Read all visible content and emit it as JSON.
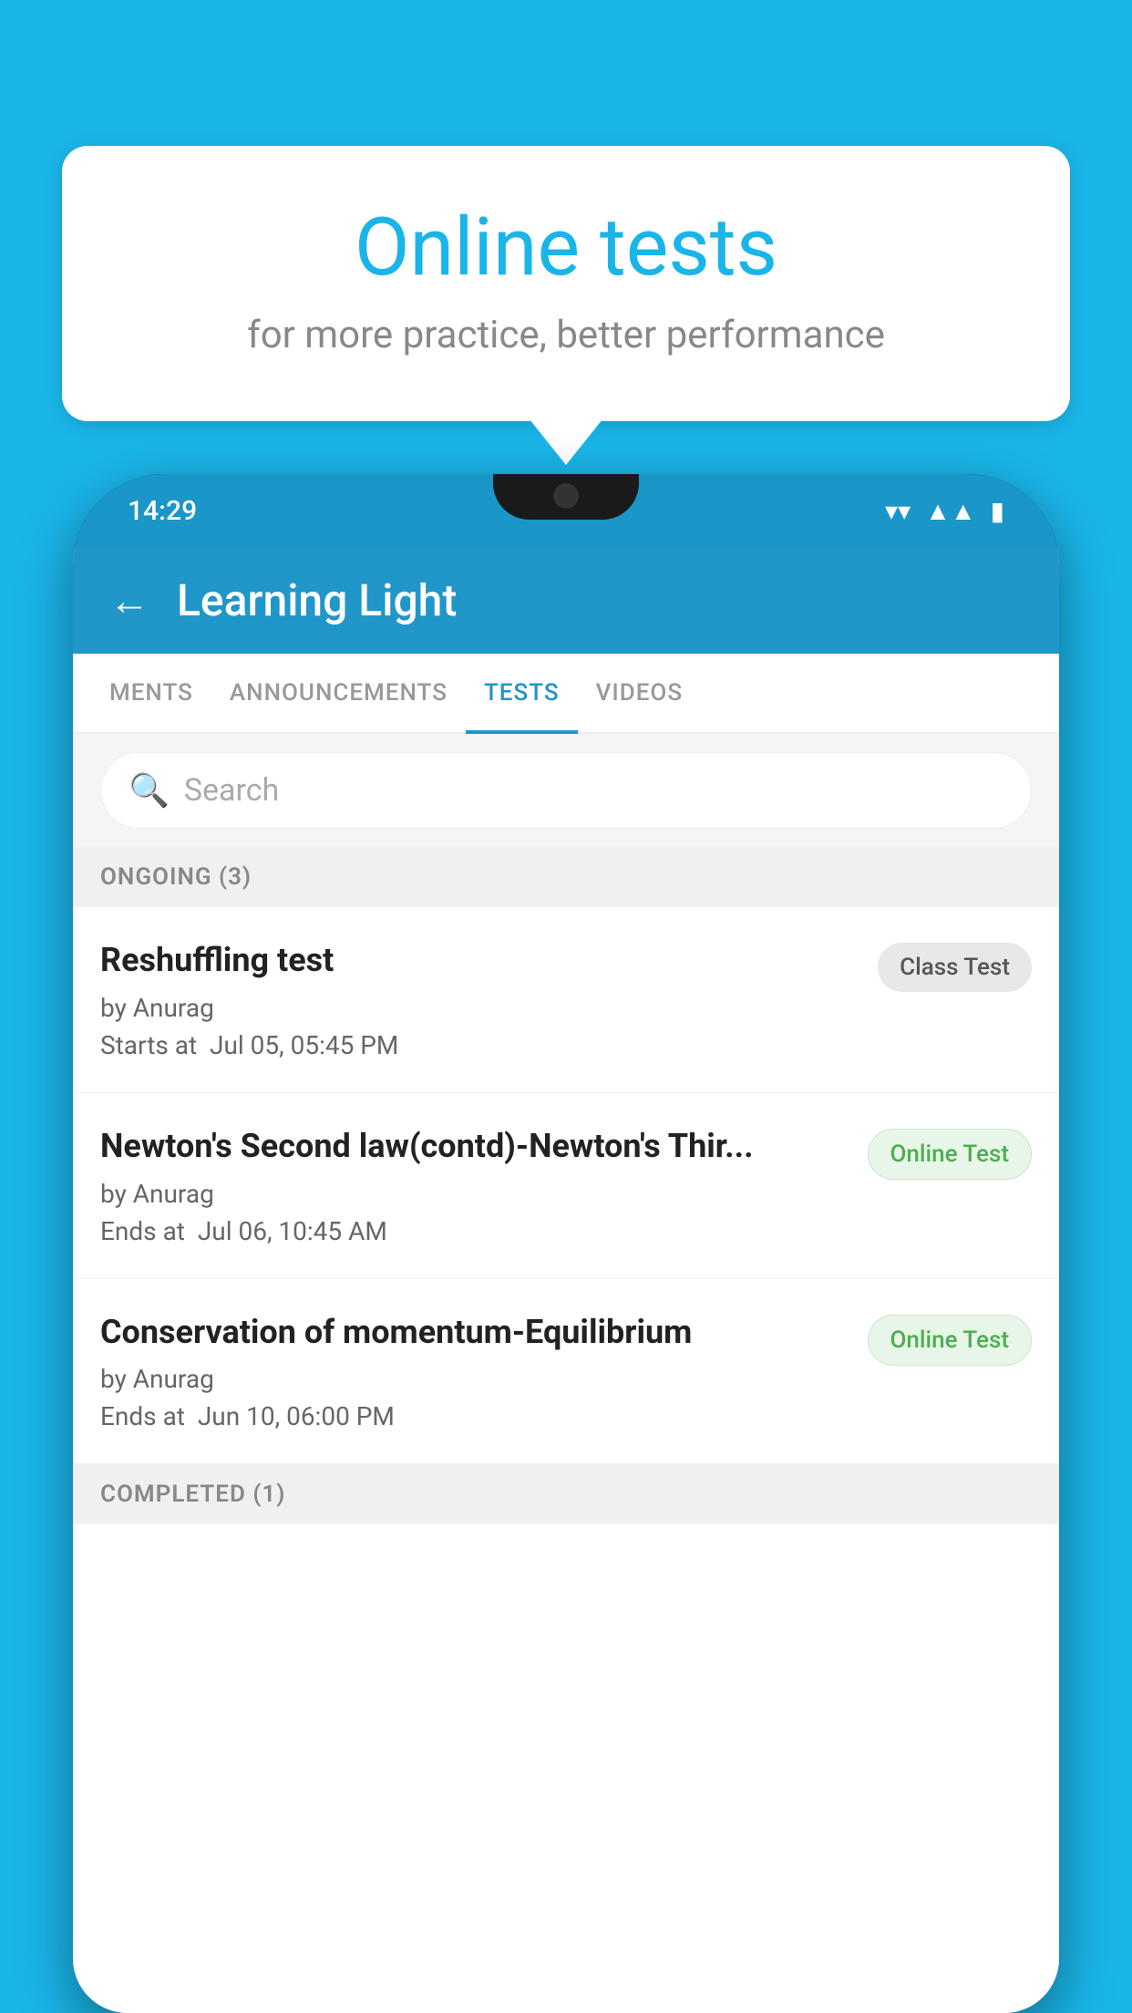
{
  "background": {
    "color": "#1ab5e8"
  },
  "speech_bubble": {
    "title": "Online tests",
    "subtitle": "for more practice, better performance"
  },
  "phone": {
    "status_bar": {
      "time": "14:29",
      "wifi": "▼",
      "signal": "▲",
      "battery": "▮"
    },
    "header": {
      "title": "Learning Light",
      "back_label": "←"
    },
    "tabs": [
      {
        "label": "MENTS",
        "active": false
      },
      {
        "label": "ANNOUNCEMENTS",
        "active": false
      },
      {
        "label": "TESTS",
        "active": true
      },
      {
        "label": "VIDEOS",
        "active": false
      }
    ],
    "search": {
      "placeholder": "Search"
    },
    "ongoing_section": {
      "label": "ONGOING (3)"
    },
    "tests": [
      {
        "name": "Reshuffling test",
        "author": "by Anurag",
        "time_label": "Starts at",
        "time": "Jul 05, 05:45 PM",
        "badge": "Class Test",
        "badge_type": "class"
      },
      {
        "name": "Newton's Second law(contd)-Newton's Thir...",
        "author": "by Anurag",
        "time_label": "Ends at",
        "time": "Jul 06, 10:45 AM",
        "badge": "Online Test",
        "badge_type": "online"
      },
      {
        "name": "Conservation of momentum-Equilibrium",
        "author": "by Anurag",
        "time_label": "Ends at",
        "time": "Jun 10, 06:00 PM",
        "badge": "Online Test",
        "badge_type": "online"
      }
    ],
    "completed_section": {
      "label": "COMPLETED (1)"
    }
  }
}
